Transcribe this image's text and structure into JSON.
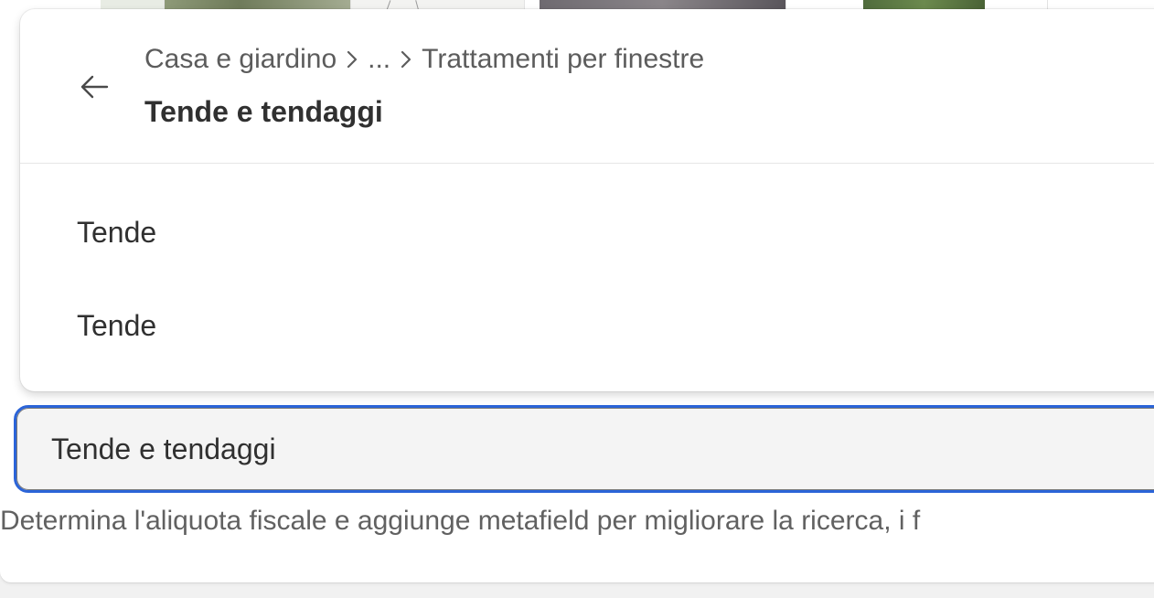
{
  "thumbnails": [
    "product-image",
    "product-image",
    "product-image",
    "product-image",
    "product-image"
  ],
  "popover": {
    "back_icon": "arrow-left-icon",
    "breadcrumb": {
      "root": "Casa e giardino",
      "ellipsis": "...",
      "parent": "Trattamenti per finestre",
      "separator_icon": "chevron-right-icon"
    },
    "title": "Tende e tendaggi",
    "options": [
      {
        "label": "Tende"
      },
      {
        "label": "Tende"
      }
    ]
  },
  "category_field": {
    "value": "Tende e tendaggi",
    "focus_color": "#2b64d8"
  },
  "help_text": "Determina l'aliquota fiscale e aggiunge metafield per migliorare la ricerca, i f"
}
